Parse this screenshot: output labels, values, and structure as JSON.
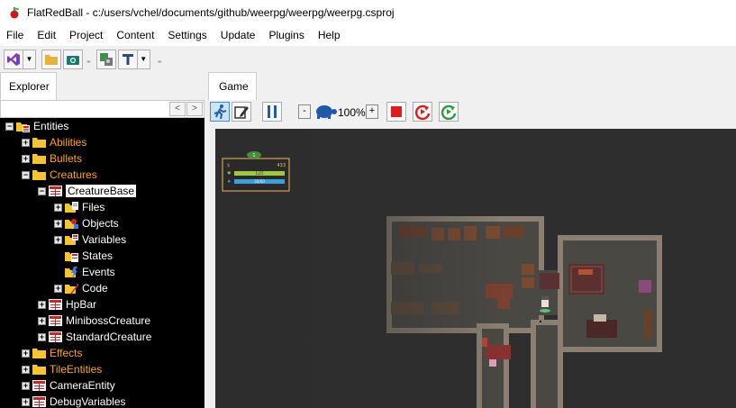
{
  "window": {
    "title": "FlatRedBall - c:/users/vchel/documents/github/weerpg/weerpg/weerpg.csproj"
  },
  "menu": [
    "File",
    "Edit",
    "Project",
    "Content",
    "Settings",
    "Update",
    "Plugins",
    "Help"
  ],
  "toolbar": {
    "icons": [
      "visual-studio-icon",
      "dropdown-icon",
      "folder-icon",
      "camera-icon",
      "puzzle-icon",
      "text-tool-icon",
      "dropdown-icon"
    ]
  },
  "explorer": {
    "tab_label": "Explorer",
    "search_value": "",
    "nav_prev": "<",
    "nav_next": ">",
    "tree": [
      {
        "label": "Entities",
        "level": 0,
        "expander": "−",
        "icon": "entities",
        "color": "white"
      },
      {
        "label": "Abilities",
        "level": 1,
        "expander": "+",
        "icon": "folder",
        "color": "orange"
      },
      {
        "label": "Bullets",
        "level": 1,
        "expander": "+",
        "icon": "folder",
        "color": "orange"
      },
      {
        "label": "Creatures",
        "level": 1,
        "expander": "−",
        "icon": "folder",
        "color": "orange"
      },
      {
        "label": "CreatureBase",
        "level": 2,
        "expander": "−",
        "icon": "entity",
        "color": "white",
        "selected": true
      },
      {
        "label": "Files",
        "level": 3,
        "expander": "+",
        "icon": "files",
        "color": "white"
      },
      {
        "label": "Objects",
        "level": 3,
        "expander": "+",
        "icon": "objects",
        "color": "white"
      },
      {
        "label": "Variables",
        "level": 3,
        "expander": "+",
        "icon": "variables",
        "color": "white"
      },
      {
        "label": "States",
        "level": 3,
        "expander": "",
        "icon": "states",
        "color": "white"
      },
      {
        "label": "Events",
        "level": 3,
        "expander": "",
        "icon": "events",
        "color": "white"
      },
      {
        "label": "Code",
        "level": 3,
        "expander": "+",
        "icon": "code",
        "color": "white"
      },
      {
        "label": "HpBar",
        "level": 2,
        "expander": "+",
        "icon": "entity",
        "color": "white"
      },
      {
        "label": "MinibossCreature",
        "level": 2,
        "expander": "+",
        "icon": "entity",
        "color": "white"
      },
      {
        "label": "StandardCreature",
        "level": 2,
        "expander": "+",
        "icon": "entity",
        "color": "white"
      },
      {
        "label": "Effects",
        "level": 1,
        "expander": "+",
        "icon": "folder",
        "color": "orange"
      },
      {
        "label": "TileEntities",
        "level": 1,
        "expander": "+",
        "icon": "folder",
        "color": "orange"
      },
      {
        "label": "CameraEntity",
        "level": 1,
        "expander": "+",
        "icon": "entity",
        "color": "white"
      },
      {
        "label": "DebugVariables",
        "level": 1,
        "expander": "+",
        "icon": "entity",
        "color": "white"
      }
    ]
  },
  "game": {
    "tab_label": "Game",
    "zoom_minus": "-",
    "zoom_plus": "+",
    "zoom_value": "100%",
    "hud": {
      "level": "1",
      "gold": "433",
      "hp": "1/25",
      "mp": "33/50"
    }
  },
  "colors": {
    "folder": "#f5c431",
    "orange_label": "#ffa500",
    "tree_bg": "#000000",
    "entity_red": "#d42020"
  }
}
